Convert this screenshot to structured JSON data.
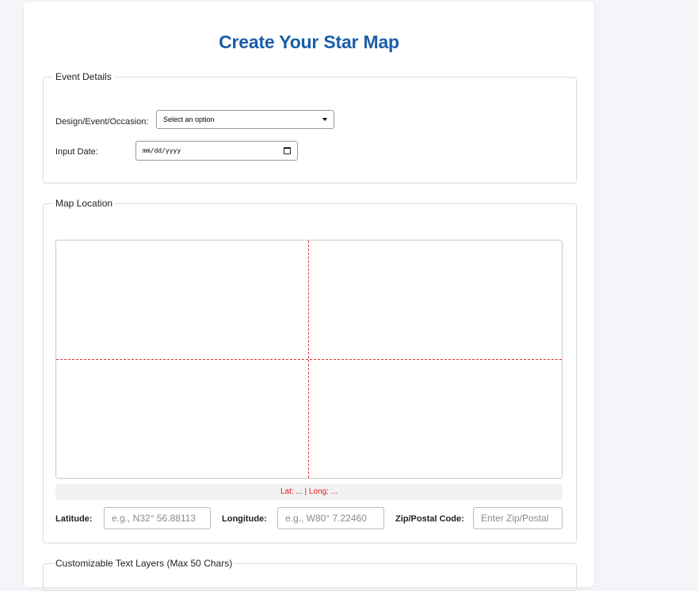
{
  "page": {
    "title": "Create Your Star Map"
  },
  "event_details": {
    "legend": "Event Details",
    "design_label": "Design/Event/Occasion:",
    "design_select_value": "Select an option",
    "date_label": "Input Date:",
    "date_value": "mm/dd/yyyy"
  },
  "map_location": {
    "legend": "Map Location",
    "coord_readout": "Lat: ... | Long: ...",
    "latitude_label": "Latitude:",
    "latitude_placeholder": "e.g., N32° 56.88113",
    "longitude_label": "Longitude:",
    "longitude_placeholder": "e.g., W80° 7.22460",
    "zip_label": "Zip/Postal Code:",
    "zip_placeholder": "Enter Zip/Postal"
  },
  "text_layers": {
    "legend": "Customizable Text Layers (Max 50 Chars)"
  },
  "colors": {
    "title": "#1a5ea8",
    "crosshair": "#d33333",
    "coord_text": "#e0181b"
  },
  "icons": {
    "select_caret": "chevron-down-icon",
    "date_picker": "calendar-icon"
  }
}
